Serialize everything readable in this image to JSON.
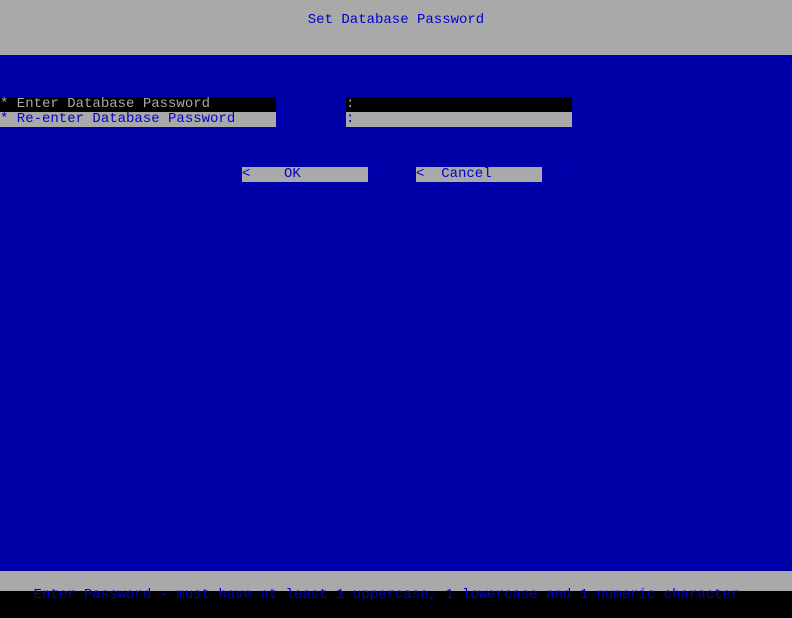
{
  "title": "Set Database Password",
  "fields": {
    "enter": {
      "label": "* Enter Database Password",
      "colon": ":",
      "value": ""
    },
    "reenter": {
      "label": "* Re-enter Database Password",
      "colon": ":",
      "value": ""
    }
  },
  "buttons": {
    "ok": "<    OK         >",
    "cancel": "<  Cancel        >"
  },
  "status": "Enter Password - must have at least 1 uppercase, 1 lowercase and 1 numeric character"
}
